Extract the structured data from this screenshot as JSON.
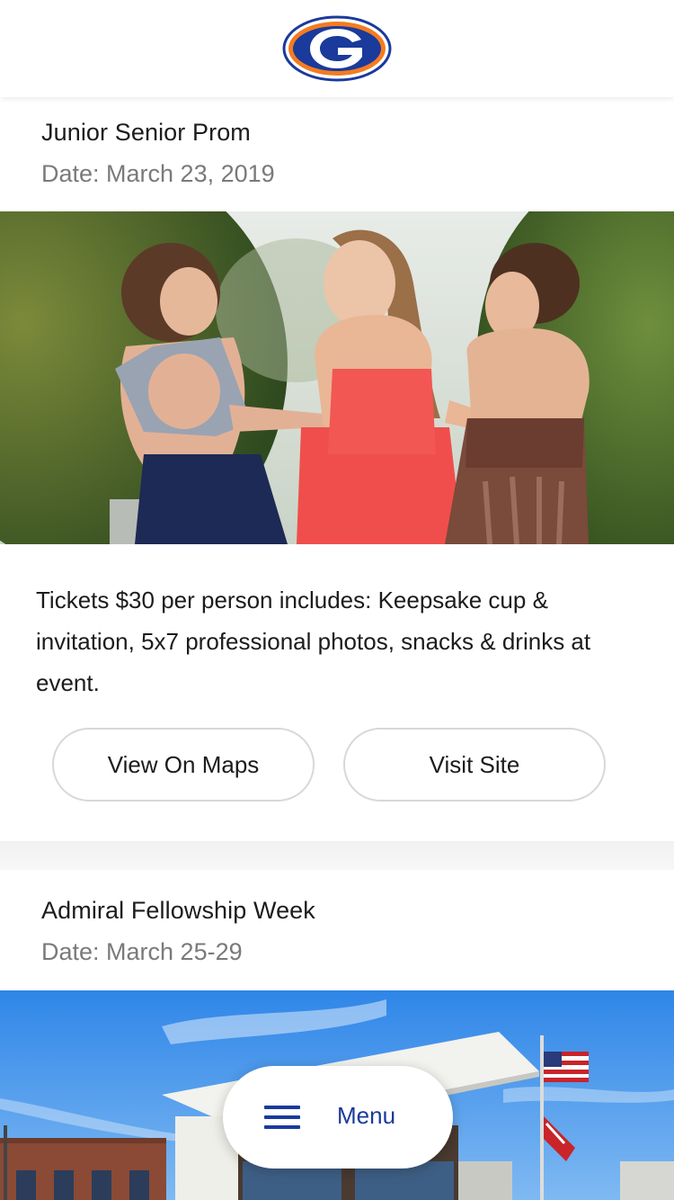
{
  "brand": {
    "logo_letter": "G",
    "logo_icon": "school-g-logo-icon",
    "primary_color": "#1a3a9c",
    "accent_color": "#f47b20"
  },
  "events": [
    {
      "title": "Junior Senior Prom",
      "date": "Date: March 23, 2019",
      "image_icon": "prom-girls-photo",
      "description": "Tickets $30 per person includes: Keepsake cup & invitation, 5x7 professional photos, snacks & drinks at event.",
      "buttons": {
        "maps_label": "View On Maps",
        "site_label": "Visit Site"
      }
    },
    {
      "title": "Admiral Fellowship Week",
      "date": "Date: March 25-29",
      "image_icon": "school-building-photo"
    }
  ],
  "menu": {
    "label": "Menu",
    "icon": "hamburger-icon"
  }
}
